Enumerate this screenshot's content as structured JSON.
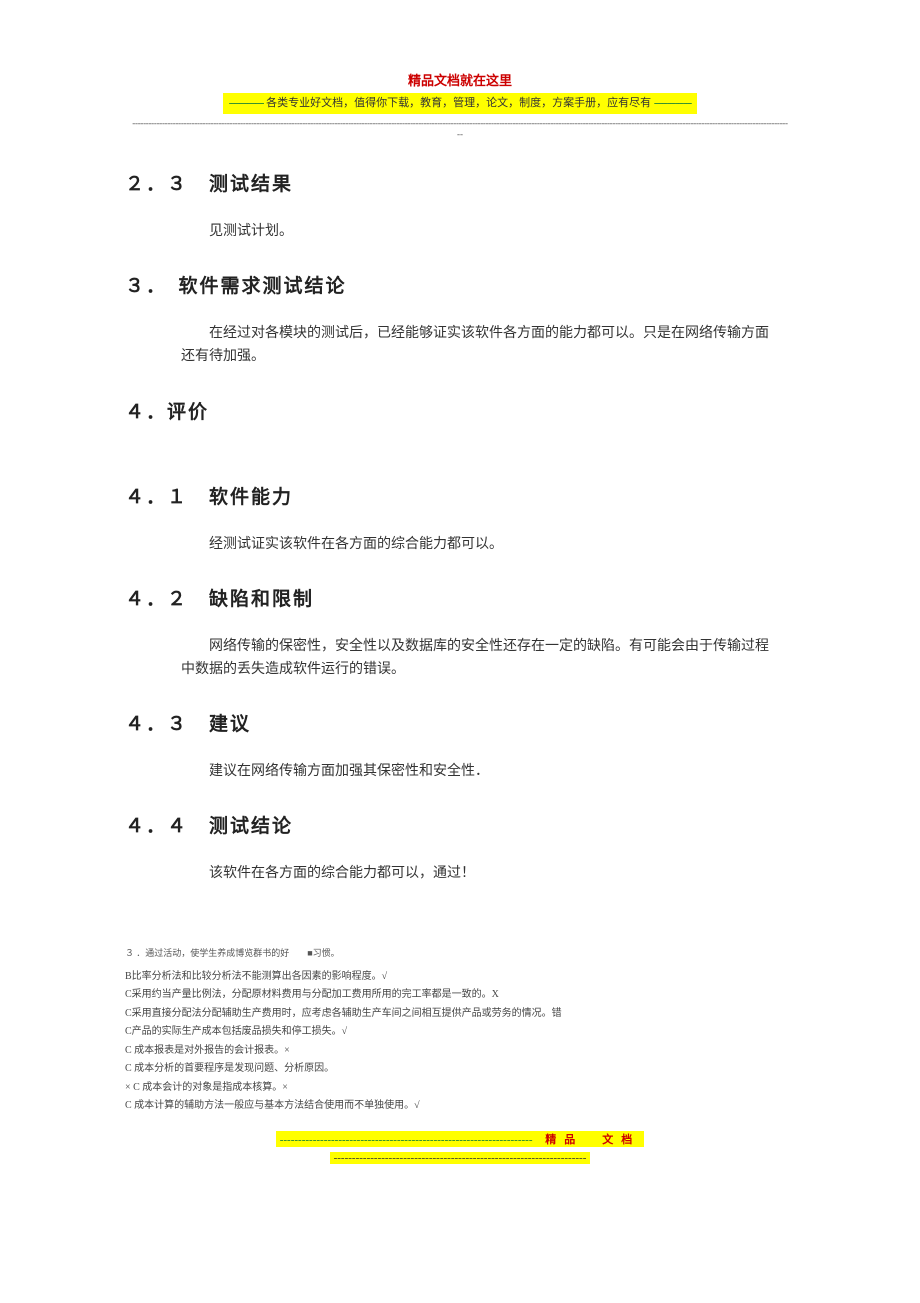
{
  "header": {
    "title": "精品文档就在这里",
    "banner_left_dashes": "-------------",
    "banner_text": "各类专业好文档，值得你下载，教育，管理，论文，制度，方案手册，应有尽有",
    "banner_right_dashes": "--------------",
    "dash_row1": "---------------------------------------------------------------------------------------------------------------------------------------------------------------------------------------------------------------------------------------------------",
    "dash_row2": "--"
  },
  "s23": {
    "heading": "２．３　测试结果",
    "body": "见测试计划。"
  },
  "s3": {
    "heading": "３．　软件需求测试结论",
    "body": "在经过对各模块的测试后，已经能够证实该软件各方面的能力都可以。只是在网络传输方面还有待加强。"
  },
  "s4": {
    "heading": "４．评价"
  },
  "s41": {
    "heading": "４．１　软件能力",
    "body": "经测试证实该软件在各方面的综合能力都可以。"
  },
  "s42": {
    "heading": "４．２　缺陷和限制",
    "body": "网络传输的保密性，安全性以及数据库的安全性还存在一定的缺陷。有可能会由于传输过程中数据的丢失造成软件运行的错误。"
  },
  "s43": {
    "heading": "４．３　建议",
    "body": "建议在网络传输方面加强其保密性和安全性．"
  },
  "s44": {
    "heading": "４．４　测试结论",
    "body": "该软件在各方面的综合能力都可以，通过！"
  },
  "footnotes": {
    "small": "３ ．通过活动，使学生养成博览群书的好　　■习惯。",
    "lines": [
      "B比率分析法和比较分析法不能测算出各因素的影响程度。√",
      "C采用约当产量比例法，分配原材料费用与分配加工费用所用的完工率都是一致的。X",
      "C采用直接分配法分配辅助生产费用时，应考虑各辅助生产车间之间相互提供产品或劳务的情况。错",
      "C产品的实际生产成本包括废品损失和停工损失。√",
      "C 成本报表是对外报告的会计报表。×",
      "C 成本分析的首要程序是发现问题、分析原因。",
      "× C 成本会计的对象是指成本核算。×",
      "C 成本计算的辅助方法一般应与基本方法结合使用而不单独使用。√"
    ]
  },
  "footer": {
    "line1_dashes": "---------------------------------------------------------------------",
    "label": "精品　文档",
    "line2_dashes": "---------------------------------------------------------------------"
  }
}
